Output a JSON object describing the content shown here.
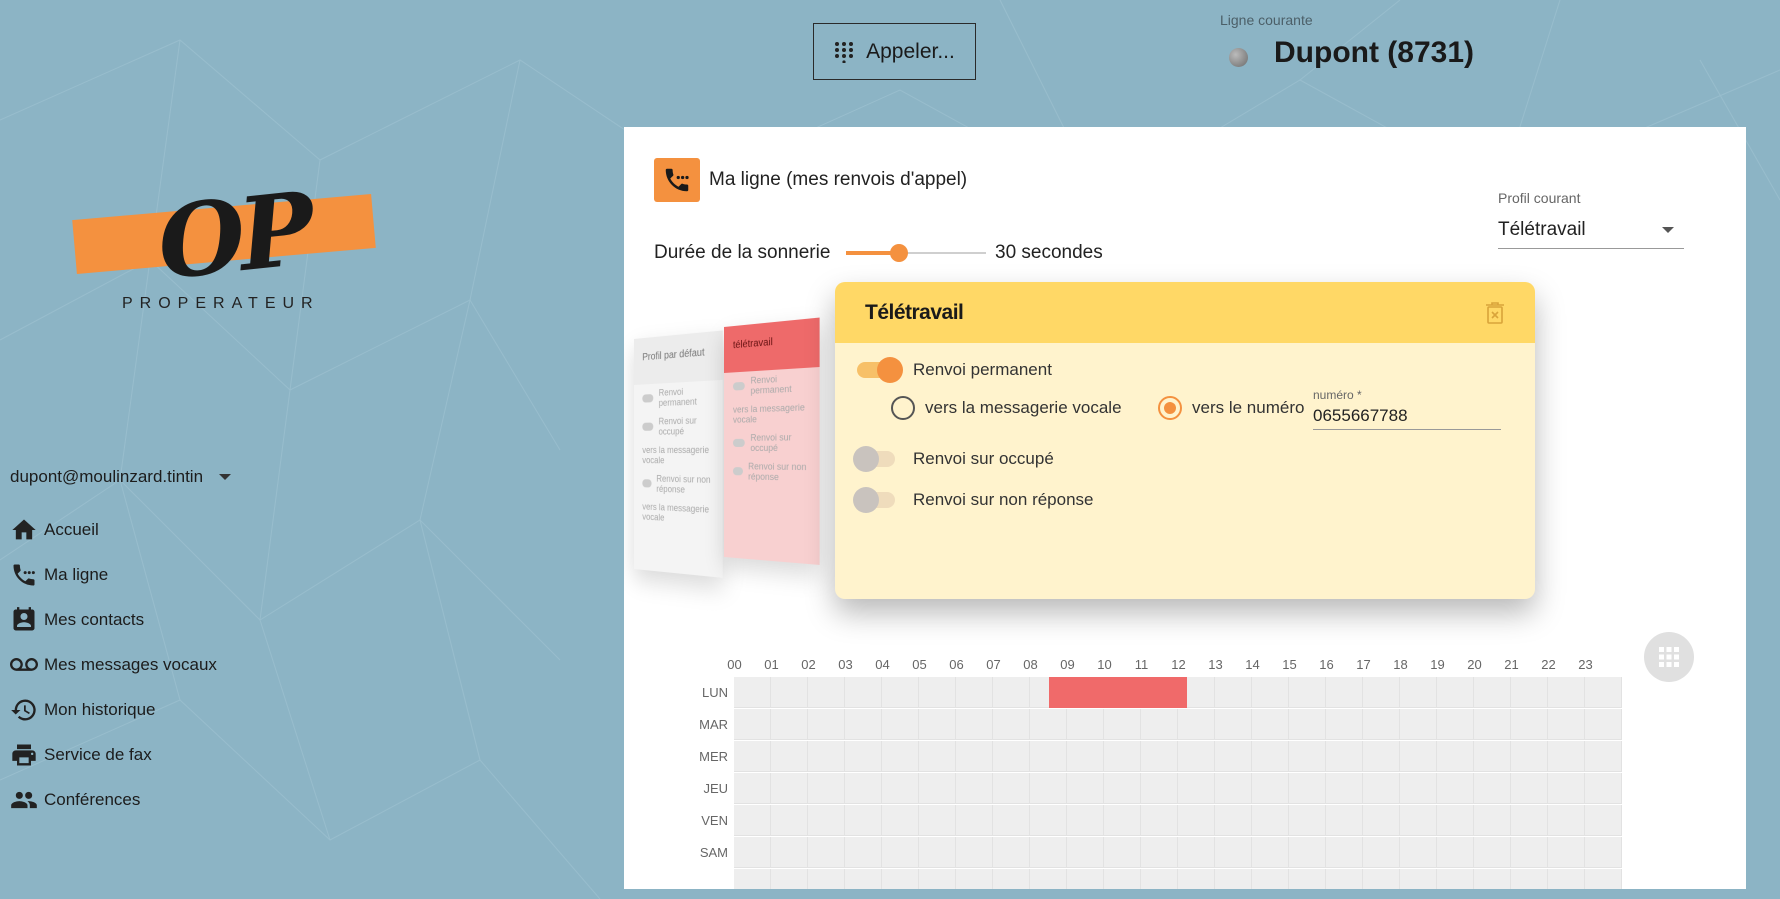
{
  "brand": {
    "logo_text": "OP",
    "logo_sub": "PROPERATEUR",
    "accent": "#f4913f"
  },
  "user": {
    "email": "dupont@moulinzard.tintin"
  },
  "nav": {
    "items": [
      {
        "label": "Accueil",
        "icon": "home-icon"
      },
      {
        "label": "Ma ligne",
        "icon": "phone-dots-icon"
      },
      {
        "label": "Mes contacts",
        "icon": "contact-card-icon"
      },
      {
        "label": "Mes messages vocaux",
        "icon": "voicemail-icon"
      },
      {
        "label": "Mon historique",
        "icon": "history-icon"
      },
      {
        "label": "Service de fax",
        "icon": "printer-icon"
      },
      {
        "label": "Conférences",
        "icon": "people-icon"
      }
    ]
  },
  "topbar": {
    "call_label": "Appeler...",
    "line_label": "Ligne courante",
    "line_name": "Dupont (8731)"
  },
  "card": {
    "title": "Ma ligne (mes renvois d'appel)",
    "ring_label": "Durée de la sonnerie",
    "ring_value": "30 secondes",
    "ring_fraction": 0.38,
    "profil_label": "Profil courant",
    "profil_value": "Télétravail"
  },
  "ghost_cards": [
    {
      "title": "Profil par défaut",
      "rows": [
        "Renvoi permanent",
        "Renvoi sur occupé",
        "vers la messagerie vocale",
        "Renvoi sur non réponse",
        "vers la messagerie vocale"
      ]
    },
    {
      "title": "télétravail",
      "rows": [
        "Renvoi permanent",
        "vers la messagerie vocale",
        "Renvoi sur occupé",
        "Renvoi sur non réponse"
      ]
    }
  ],
  "profile": {
    "title": "Télétravail",
    "permanent": "Renvoi permanent",
    "voicemail": "vers la messagerie vocale",
    "to_number": "vers le numéro",
    "number_label": "numéro *",
    "number_value": "0655667788",
    "busy": "Renvoi sur occupé",
    "no_answer": "Renvoi sur non réponse"
  },
  "schedule": {
    "hours": [
      "00",
      "01",
      "02",
      "03",
      "04",
      "05",
      "06",
      "07",
      "08",
      "09",
      "10",
      "11",
      "12",
      "13",
      "14",
      "15",
      "16",
      "17",
      "18",
      "19",
      "20",
      "21",
      "22",
      "23"
    ],
    "days": [
      "LUN",
      "MAR",
      "MER",
      "JEU",
      "VEN",
      "SAM"
    ],
    "slots": [
      {
        "day": "LUN",
        "start": 8.5,
        "end": 12.25,
        "color": "#f06a6a"
      }
    ]
  }
}
